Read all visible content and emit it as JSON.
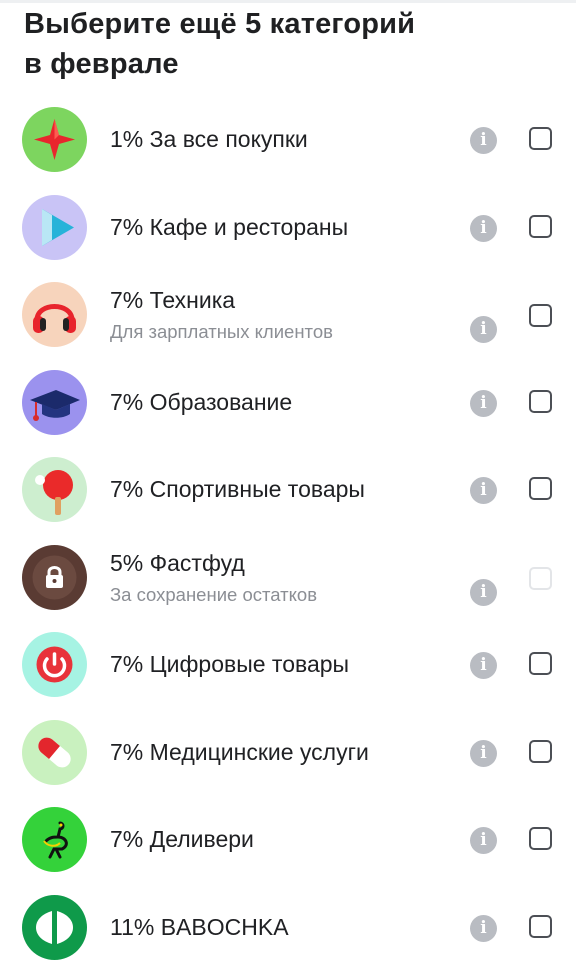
{
  "header": {
    "title_line1": "Выберите ещё 5 категорий",
    "title_line2": "в феврале"
  },
  "categories": [
    {
      "label": "1% За все покупки",
      "sub": "",
      "icon": "star-icon",
      "bg": "#7dd55f",
      "disabled": false
    },
    {
      "label": "7% Кафе и рестораны",
      "sub": "",
      "icon": "play-icon",
      "bg": "#c9c4f6",
      "disabled": false
    },
    {
      "label": "7% Техника",
      "sub": "Для зарплатных клиентов",
      "icon": "headphones-icon",
      "bg": "#f7d4bc",
      "disabled": false
    },
    {
      "label": "7% Образование",
      "sub": "",
      "icon": "graduation-cap-icon",
      "bg": "#9b92ee",
      "disabled": false
    },
    {
      "label": "7% Спортивные товары",
      "sub": "",
      "icon": "ping-pong-icon",
      "bg": "#cdeecf",
      "disabled": false
    },
    {
      "label": "5% Фастфуд",
      "sub": "За сохранение остатков",
      "icon": "lock-icon",
      "bg": "#5a3b33",
      "disabled": true
    },
    {
      "label": "7% Цифровые товары",
      "sub": "",
      "icon": "power-icon",
      "bg": "#a6f3e3",
      "disabled": false
    },
    {
      "label": "7% Медицинские услуги",
      "sub": "",
      "icon": "pill-icon",
      "bg": "#c9f1bf",
      "disabled": false
    },
    {
      "label": "7% Деливери",
      "sub": "",
      "icon": "ostrich-icon",
      "bg": "#34d23a",
      "disabled": false
    },
    {
      "label": "11% BABOCHKA",
      "sub": "",
      "icon": "butterfly-icon",
      "bg": "#0f9a4a",
      "disabled": false
    }
  ],
  "info_symbol": "i"
}
